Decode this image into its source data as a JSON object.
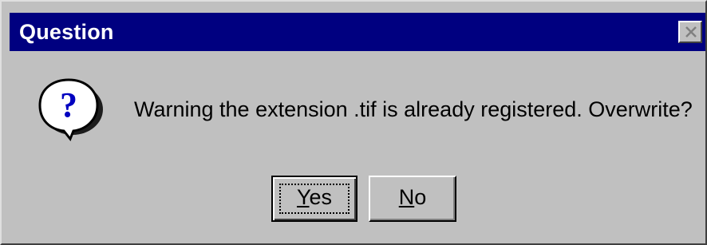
{
  "dialog": {
    "title": "Question",
    "message": "Warning the extension .tif is already registered. Overwrite?",
    "icon": "question-icon",
    "buttons": {
      "yes": {
        "mnemonic": "Y",
        "rest": "es"
      },
      "no": {
        "mnemonic": "N",
        "rest": "o"
      }
    },
    "colors": {
      "titlebar": "#000080",
      "face": "#c0c0c0",
      "icon": "#0000c0"
    }
  }
}
